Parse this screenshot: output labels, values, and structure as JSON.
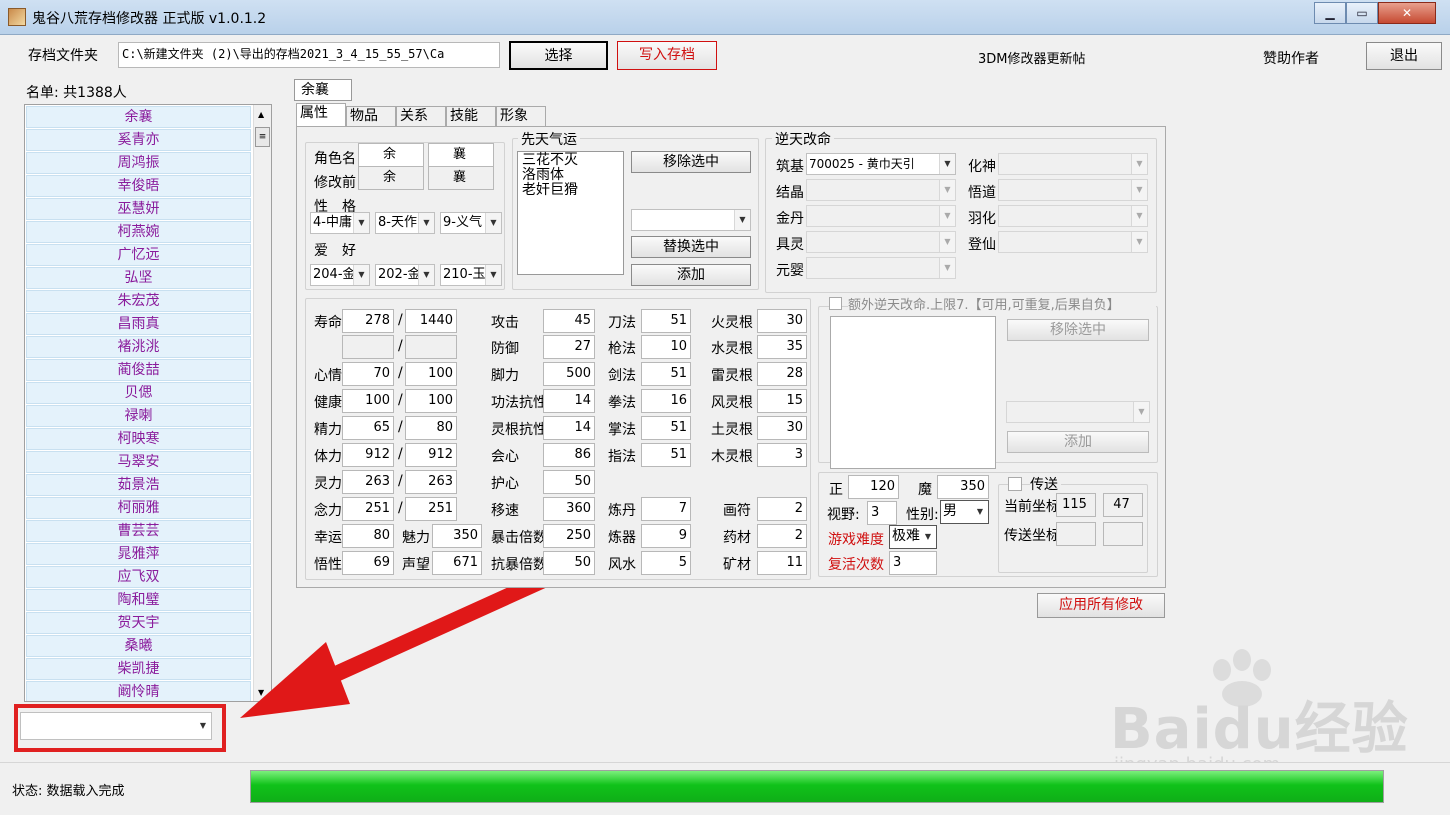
{
  "window": {
    "title": "鬼谷八荒存档修改器 正式版 v1.0.1.2"
  },
  "toolbar": {
    "folder_label": "存档文件夹",
    "folder_path": "C:\\新建文件夹 (2)\\导出的存档2021_3_4_15_55_57\\Ca",
    "select": "选择",
    "write": "写入存档",
    "update_post": "3DM修改器更新帖",
    "sponsor": "赞助作者",
    "exit": "退出"
  },
  "roster": {
    "header": "名单: 共1388人",
    "names": [
      "余襄",
      "奚青亦",
      "周鸿振",
      "幸俊晤",
      "巫慧妍",
      "柯燕婉",
      "广忆远",
      "弘坚",
      "朱宏茂",
      "昌雨真",
      "褚洮洮",
      "蔺俊喆",
      "贝偲",
      "禄喇",
      "柯映寒",
      "马翠安",
      "茹景浩",
      "柯丽雅",
      "曹芸芸",
      "晁雅萍",
      "应飞双",
      "陶和璧",
      "贺天宇",
      "桑曦",
      "柴凯捷",
      "阚怜晴"
    ]
  },
  "selected_char": "余襄",
  "tabs": [
    "属性",
    "物品",
    "关系",
    "技能",
    "形象"
  ],
  "basic": {
    "name_label": "角色名",
    "before_label": "修改前",
    "name1": "余",
    "name2": "襄",
    "before1": "余",
    "before2": "襄",
    "char_label": "性　格",
    "c1": "4-中庸",
    "c2": "8-天作",
    "c3": "9-义气",
    "hobby_label": "爱　好",
    "h1": "204-金",
    "h2": "202-金",
    "h3": "210-玉"
  },
  "innate": {
    "title": "先天气运",
    "items": [
      "三花不灭",
      "洛雨体",
      "老奸巨猾"
    ],
    "remove": "移除选中",
    "replace": "替换选中",
    "add": "添加"
  },
  "fate": {
    "title": "逆天改命",
    "zhuji_label": "筑基",
    "zhuji_value": "700025 - 黄巾天引",
    "jiejing": "结晶",
    "jindan": "金丹",
    "juling": "具灵",
    "yuanying": "元婴",
    "huashen": "化神",
    "wudao": "悟道",
    "yuhua": "羽化",
    "dengxian": "登仙"
  },
  "stats": {
    "shouming": "寿命",
    "sm1": "278",
    "sm2": "1440",
    "xinqing": "心情",
    "xq1": "70",
    "xq2": "100",
    "jiankang": "健康",
    "jk1": "100",
    "jk2": "100",
    "jingli": "精力",
    "jl1": "65",
    "jl2": "80",
    "tili": "体力",
    "tl1": "912",
    "tl2": "912",
    "lingli": "灵力",
    "ll1": "263",
    "ll2": "263",
    "nianli": "念力",
    "nl1": "251",
    "nl2": "251",
    "xingyun": "幸运",
    "xy": "80",
    "meili": "魅力",
    "ml": "350",
    "wuxing": "悟性",
    "wx": "69",
    "shengwang": "声望",
    "sw": "671",
    "gongji": "攻击",
    "gj": "45",
    "fangyu": "防御",
    "fy": "27",
    "jiaoli": "脚力",
    "jli": "500",
    "gfkx": "功法抗性",
    "gfkx_v": "14",
    "lgkx": "灵根抗性",
    "lgkx_v": "14",
    "huixin": "会心",
    "hx": "86",
    "huxin": "护心",
    "hxx": "50",
    "yisu": "移速",
    "ys": "360",
    "bjbs": "暴击倍数",
    "bjbs_v": "250",
    "kbbs": "抗暴倍数",
    "kbbs_v": "50",
    "daofa": "刀法",
    "df": "51",
    "qiangfa": "枪法",
    "qf": "10",
    "jianfa": "剑法",
    "jf": "51",
    "quanfa": "拳法",
    "qfa": "16",
    "zhangfa": "掌法",
    "zf": "51",
    "zhifa": "指法",
    "zhf": "51",
    "liandan": "炼丹",
    "ld": "7",
    "lianqi": "炼器",
    "lq": "9",
    "fengshui": "风水",
    "fs": "5",
    "huo": "火灵根",
    "huo_v": "30",
    "shui": "水灵根",
    "shui_v": "35",
    "lei": "雷灵根",
    "lei_v": "28",
    "feng": "风灵根",
    "feng_v": "15",
    "tu": "土灵根",
    "tu_v": "30",
    "mu": "木灵根",
    "mu_v": "3",
    "huafu": "画符",
    "hf": "2",
    "yaocai": "药材",
    "yc": "2",
    "kuangcai": "矿材",
    "kc": "11"
  },
  "extra": {
    "checkbox": "额外逆天改命.上限7.【可用,可重复,后果自负】",
    "remove": "移除选中",
    "add": "添加"
  },
  "misc": {
    "zheng": "正",
    "zheng_v": "120",
    "mo": "魔",
    "mo_v": "350",
    "shiye": "视野:",
    "shiye_v": "3",
    "xingbie": "性别:",
    "xingbie_v": "男",
    "nandu": "游戏难度",
    "nandu_v": "极难",
    "fuhuo": "复活次数",
    "fuhuo_v": "3"
  },
  "teleport": {
    "checkbox": "传送",
    "cur": "当前坐标",
    "cx": "115",
    "cy": "47",
    "target": "传送坐标"
  },
  "apply": "应用所有修改",
  "status": "状态: 数据载入完成",
  "progress": 1.0,
  "watermark": {
    "brand": "Baidu经验",
    "url": "jingyan.baidu.com"
  }
}
